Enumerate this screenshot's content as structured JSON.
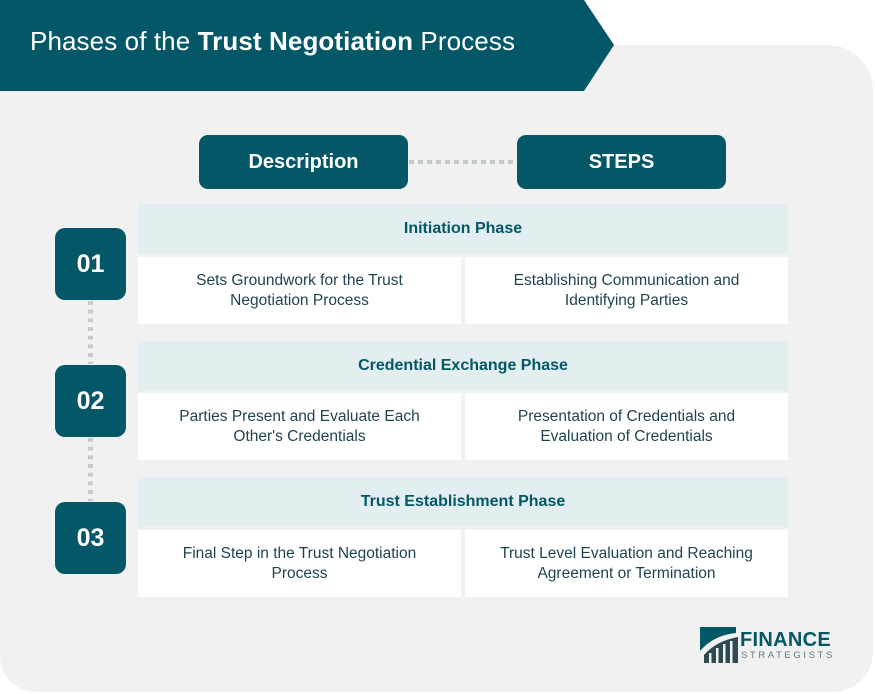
{
  "header": {
    "title_prefix": "Phases of the ",
    "title_bold": "Trust Negotiation",
    "title_suffix": " Process"
  },
  "columns": {
    "description": "Description",
    "steps": "STEPS"
  },
  "phases": [
    {
      "number": "01",
      "name": "Initiation Phase",
      "description": "Sets Groundwork for the Trust Negotiation Process",
      "steps": "Establishing Communication and Identifying Parties"
    },
    {
      "number": "02",
      "name": "Credential Exchange Phase",
      "description": "Parties Present and Evaluate Each Other's Credentials",
      "steps": "Presentation of Credentials and Evaluation of Credentials"
    },
    {
      "number": "03",
      "name": "Trust Establishment Phase",
      "description": "Final Step in the Trust Negotiation Process",
      "steps": "Trust Level Evaluation and Reaching Agreement or Termination"
    }
  ],
  "logo": {
    "line1": "FINANCE",
    "line2": "STRATEGISTS",
    "icon": "finance-strategists-logo-icon"
  },
  "colors": {
    "primary": "#035766",
    "phase_header_bg": "#e3eef0",
    "panel_bg": "#f1f1f1",
    "body_text": "#1f4450",
    "connector": "#c3cbce"
  }
}
